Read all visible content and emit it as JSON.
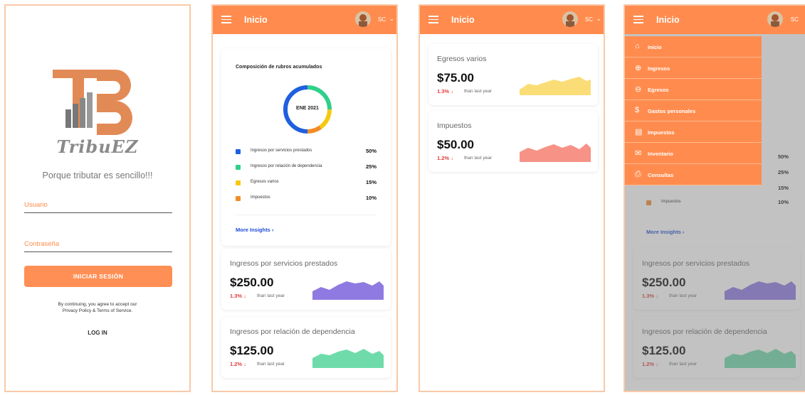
{
  "login": {
    "brand": "TribuEZ",
    "tagline": "Porque tributar es sencillo!!!",
    "username_label": "Usuario",
    "password_label": "Contraseña",
    "submit": "INICIAR SESIÓN",
    "terms_line1": "By continuing, you agree to accept our",
    "terms_line2": "Privacy Policy & Terms of Service.",
    "login_link": "LOG IN"
  },
  "header": {
    "title": "Inicio",
    "user": "SC"
  },
  "composition": {
    "title": "Composición de rubros acumulados",
    "period": "ENE 2021",
    "items": [
      {
        "label": "Ingresos por servicios prestados",
        "pct": "50%",
        "color": "#1f5fe0"
      },
      {
        "label": "Ingresos por relación de dependencia",
        "pct": "25%",
        "color": "#2fd08a"
      },
      {
        "label": "Egresos varios",
        "pct": "15%",
        "color": "#f6c90e"
      },
      {
        "label": "Impuestos",
        "pct": "10%",
        "color": "#f28c28"
      }
    ],
    "insights": "More Insights"
  },
  "cards": {
    "servicios": {
      "title": "Ingresos por servicios prestados",
      "amount": "$250.00",
      "pct": "1.3%",
      "sub": "than last year",
      "color": "#6a4ed8"
    },
    "dependencia": {
      "title": "Ingresos por relación de dependencia",
      "amount": "$125.00",
      "pct": "1.2%",
      "sub": "than last year",
      "color": "#3fcf8f"
    },
    "egresos": {
      "title": "Egresos varios",
      "amount": "$75.00",
      "pct": "1.3%",
      "sub": "than last year",
      "color": "#f8d24a"
    },
    "impuestos": {
      "title": "Impuestos",
      "amount": "$50.00",
      "pct": "1.2%",
      "sub": "than last year",
      "color": "#f46d5d"
    }
  },
  "menu": [
    {
      "label": "Inicio",
      "icon": "home-icon",
      "glyph": "⌂"
    },
    {
      "label": "Ingresos",
      "icon": "zoom-in-icon",
      "glyph": "⊕"
    },
    {
      "label": "Egresos",
      "icon": "zoom-out-icon",
      "glyph": "⊖"
    },
    {
      "label": "Gastos personales",
      "icon": "dollar-icon",
      "glyph": "$"
    },
    {
      "label": "Impuestos",
      "icon": "tax-icon",
      "glyph": "▤"
    },
    {
      "label": "Inventario",
      "icon": "envelope-icon",
      "glyph": "✉"
    },
    {
      "label": "Consultas",
      "icon": "document-search-icon",
      "glyph": "⎙"
    }
  ],
  "arrow_down": "↓",
  "chevron_right": "›"
}
